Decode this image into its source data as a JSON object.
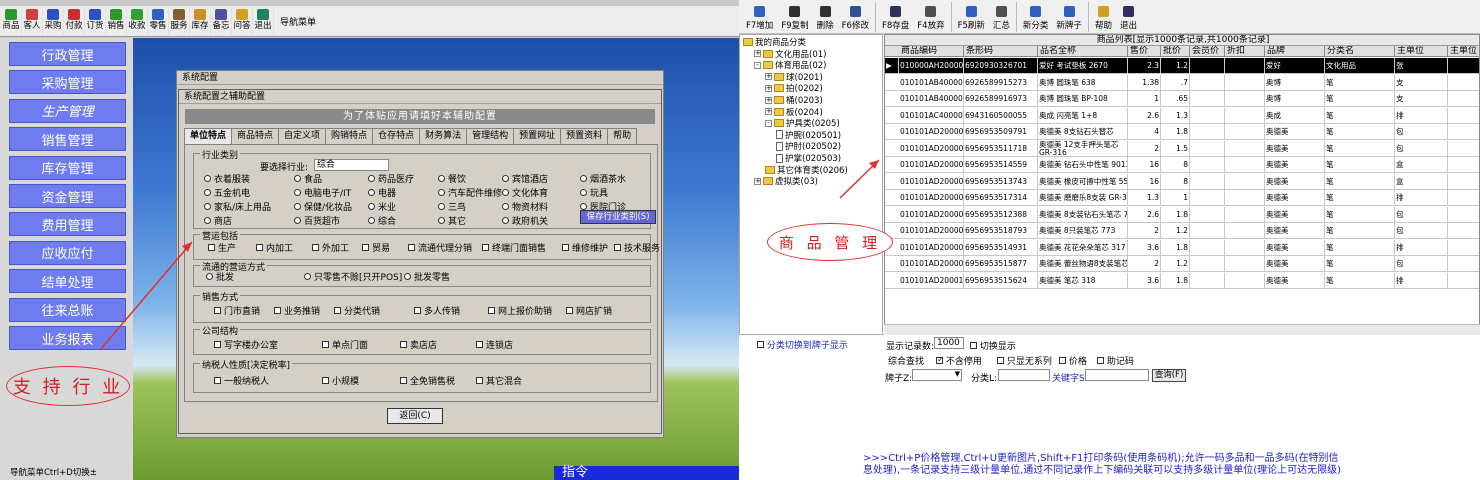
{
  "left_app": {
    "toolbar": [
      {
        "label": "商品",
        "color": "#2a9a2a"
      },
      {
        "label": "客人",
        "color": "#d04040"
      },
      {
        "label": "采购",
        "color": "#2a50c8"
      },
      {
        "label": "付款",
        "color": "#c83030"
      },
      {
        "label": "订货",
        "color": "#2a50c8"
      },
      {
        "label": "销售",
        "color": "#2a9a2a"
      },
      {
        "label": "收款",
        "color": "#30a030"
      },
      {
        "label": "零售",
        "color": "#3060c0"
      },
      {
        "label": "服务",
        "color": "#806030"
      },
      {
        "label": "库存",
        "color": "#c89020"
      },
      {
        "label": "备忘",
        "color": "#5050a0"
      },
      {
        "label": "问答",
        "color": "#d0a020"
      },
      {
        "label": "退出",
        "color": "#208060"
      }
    ],
    "nav_menu_label": "导航菜单",
    "sidebar": [
      "行政管理",
      "采购管理",
      "生产管理",
      "销售管理",
      "库存管理",
      "资金管理",
      "费用管理",
      "应收应付",
      "结单处理",
      "往来总账",
      "业务报表"
    ],
    "support_label": "支 持 行 业",
    "status_text": "导航菜单Ctrl+D切换±",
    "command_text": "指令"
  },
  "system_dialog": {
    "title": "系统配置",
    "assist_title": "系统配置之辅助配置",
    "banner": "为了体贴应用请填好本辅助配置",
    "tabs": [
      "单位特点",
      "商品特点",
      "自定义项",
      "购销特点",
      "仓存特点",
      "财务算法",
      "管理结构",
      "预置网址",
      "预置资料",
      "帮助"
    ],
    "industry": {
      "title": "行业类别",
      "prompt": "要选择行业:",
      "value": "综合",
      "options": [
        [
          "衣着服装",
          "食品",
          "药品医疗",
          "餐饮",
          "宾馆酒店",
          "烟酒茶水"
        ],
        [
          "五金机电",
          "电脑电子/IT",
          "电器",
          "汽车配件维修",
          "文化体育",
          "玩具"
        ],
        [
          "家私/床上用品",
          "保健/化妆品",
          "米业",
          "三鸟",
          "物资材料",
          "医院门诊"
        ],
        [
          "商店",
          "百货超市",
          "综合",
          "其它",
          "政府机关"
        ]
      ],
      "save_button": "保存行业类别(S)"
    },
    "business": {
      "title": "营运包括",
      "options": [
        "生产",
        "内加工",
        "外加工",
        "贸易",
        "流通代理分销",
        "终端门面销售",
        "维修维护",
        "技术服务"
      ]
    },
    "circulation": {
      "title": "流通的营运方式",
      "options": [
        "批发",
        "只零售不赊[只开POS]",
        "批发零售"
      ]
    },
    "sales": {
      "title": "销售方式",
      "options": [
        "门市直销",
        "业务推销",
        "分类代销",
        "多人传销",
        "网上报价助销",
        "网店扩销"
      ]
    },
    "company": {
      "title": "公司结构",
      "options": [
        "写字楼办公室",
        "单点门面",
        "卖店店",
        "连锁店"
      ]
    },
    "tax": {
      "title": "纳税人性质[决定税率]",
      "options": [
        "一般纳税人",
        "小规模",
        "全免销售税",
        "其它混合"
      ]
    },
    "return_button": "返回(C)"
  },
  "right_app": {
    "toolbar": [
      {
        "label": "F7增加",
        "color": "#3060c0"
      },
      {
        "label": "F9复制",
        "color": "#303030"
      },
      {
        "label": "删除",
        "color": "#303030"
      },
      {
        "label": "F6修改",
        "color": "#305090"
      },
      {
        "label": "F8存盘",
        "color": "#303060"
      },
      {
        "label": "F4放弃",
        "color": "#505050"
      },
      {
        "label": "F5刷新",
        "color": "#3060c0"
      },
      {
        "label": "汇总",
        "color": "#505050"
      },
      {
        "label": "新分类",
        "color": "#3060c0"
      },
      {
        "label": "新牌子",
        "color": "#3060c0"
      },
      {
        "label": "帮助",
        "color": "#d0a020"
      },
      {
        "label": "退出",
        "color": "#303060"
      }
    ],
    "tree": [
      {
        "label": "我的商品分类",
        "level": 0,
        "kind": "root"
      },
      {
        "label": "文化用品(01)",
        "level": 1,
        "kind": "folder",
        "pm": "+"
      },
      {
        "label": "体育用品(02)",
        "level": 1,
        "kind": "folder",
        "pm": "-"
      },
      {
        "label": "球(0201)",
        "level": 2,
        "kind": "folder",
        "pm": "+"
      },
      {
        "label": "拍(0202)",
        "level": 2,
        "kind": "folder",
        "pm": "+"
      },
      {
        "label": "桶(0203)",
        "level": 2,
        "kind": "folder",
        "pm": "+"
      },
      {
        "label": "板(0204)",
        "level": 2,
        "kind": "folder",
        "pm": "+"
      },
      {
        "label": "护具类(0205)",
        "level": 2,
        "kind": "folder",
        "pm": "-"
      },
      {
        "label": "护腕(020501)",
        "level": 3,
        "kind": "doc"
      },
      {
        "label": "护肘(020502)",
        "level": 3,
        "kind": "doc"
      },
      {
        "label": "护掌(020503)",
        "level": 3,
        "kind": "doc"
      },
      {
        "label": "其它体育类(0206)",
        "level": 2,
        "kind": "folder"
      },
      {
        "label": "虚拟类(03)",
        "level": 1,
        "kind": "folder",
        "pm": "+"
      }
    ],
    "grid_caption": "商品列表[显示1000条记录,共1000条记录]",
    "columns": [
      "商品编码",
      "条形码",
      "品名全称",
      "售价",
      "批价",
      "会员价",
      "折扣",
      "品牌",
      "分类名",
      "主单位",
      "主单位"
    ],
    "rows": [
      [
        "010000AH200001",
        "6920930326701",
        "爱好 考试垫板 2670",
        "2.3",
        "1.2",
        "",
        "",
        "爱好",
        "文化用品",
        "张"
      ],
      [
        "010101AB400001",
        "6926589915273",
        "奥博 圆珠笔 638",
        "1.38",
        ".7",
        "",
        "",
        "奥博",
        "笔",
        "支"
      ],
      [
        "010101AB400002",
        "6926589916973",
        "奥博 圆珠笔 BP-108",
        "1",
        ".65",
        "",
        "",
        "奥博",
        "笔",
        "支"
      ],
      [
        "010101AC400001",
        "6943160500055",
        "奥成 闪亮笔 1+8",
        "2.6",
        "1.3",
        "",
        "",
        "奥成",
        "笔",
        "排"
      ],
      [
        "010101AD200001",
        "6956953509791",
        "奥德美 8支钻石头替芯",
        "4",
        "1.8",
        "",
        "",
        "奥德美",
        "笔",
        "包"
      ],
      [
        "010101AD200002",
        "6956953511718",
        "奥德美 12支手押头笔芯 GR-316",
        "2",
        "1.5",
        "",
        "",
        "奥德美",
        "笔",
        "包"
      ],
      [
        "010101AD200003",
        "6956953514559",
        "奥德美 钻石头中性笔 9013",
        "16",
        "8",
        "",
        "",
        "奥德美",
        "笔",
        "盒"
      ],
      [
        "010101AD200004",
        "6956953513743",
        "奥德美 橡皮可擦中性笔 5526",
        "16",
        "8",
        "",
        "",
        "奥德美",
        "笔",
        "盒"
      ],
      [
        "010101AD200005",
        "6956953517314",
        "奥德美 磨磨乐8支装 GR-3001",
        "1.3",
        "1",
        "",
        "",
        "奥德美",
        "笔",
        "排"
      ],
      [
        "010101AD200006",
        "6956953512388",
        "奥德美 8支装钻石头笔芯 797",
        "2.6",
        "1.8",
        "",
        "",
        "奥德美",
        "笔",
        "包"
      ],
      [
        "010101AD200007",
        "6956953518793",
        "奥德美 8只装笔芯 773",
        "2",
        "1.2",
        "",
        "",
        "奥德美",
        "笔",
        "包"
      ],
      [
        "010101AD200008",
        "6956953514931",
        "奥德美 花花朵朵笔芯 317",
        "3.6",
        "1.8",
        "",
        "",
        "奥德美",
        "笔",
        "排"
      ],
      [
        "010101AD200009",
        "6956953515877",
        "奥德美 蕾丝物语8支装笔芯 769",
        "2",
        "1.2",
        "",
        "",
        "奥德美",
        "笔",
        "包"
      ],
      [
        "010101AD200010",
        "6956953515624",
        "奥德美 笔芯 318",
        "3.6",
        "1.8",
        "",
        "",
        "奥德美",
        "笔",
        "排"
      ]
    ],
    "mgmt_label": "商 品 管 理",
    "category_toggle": "分类切换到牌子显示",
    "show_records_label": "显示记录数:",
    "show_records_value": "1000",
    "switch_display": "切换显示",
    "combined_search": "综合查找",
    "include_disabled": "不含停用",
    "only_no_series": "只显无系列",
    "price": "价格",
    "mnemonic": "助记码",
    "brand_label": "牌子Z:",
    "category_label": "分类L:",
    "keyword_label": "关键字S:",
    "query_button": "查询(F)",
    "tip_text": ">>>Ctrl+P价格管理,Ctrl+U更新图片,Shift+F1打印条码(使用条码机);允许一码多品和一品多码(在特别信息处理),一条记录支持三级计量单位,通过不同记录作上下编码关联可以支持多级计量单位(理论上可达无限级)"
  }
}
